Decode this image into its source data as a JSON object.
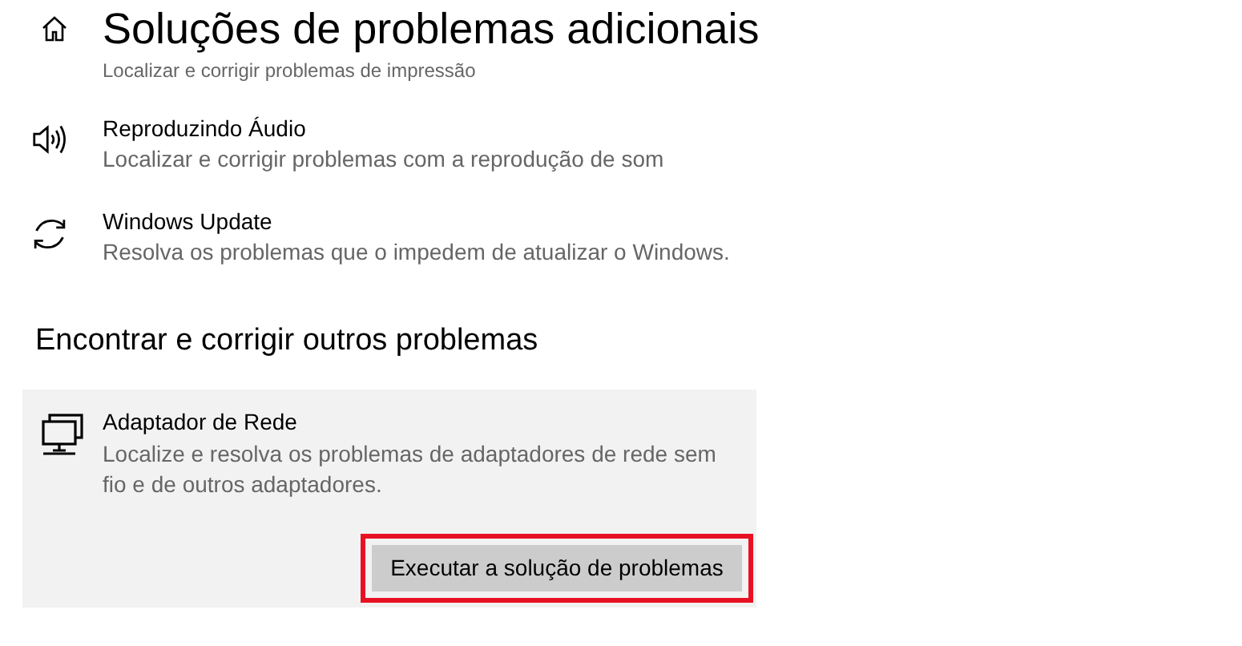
{
  "header": {
    "title": "Soluções de problemas adicionais"
  },
  "items": [
    {
      "kind": "printer",
      "description": "Localizar e corrigir problemas de impressão"
    },
    {
      "kind": "audio",
      "title": "Reproduzindo Áudio",
      "description": "Localizar e corrigir problemas com a reprodução de som"
    },
    {
      "kind": "update",
      "title": "Windows Update",
      "description": "Resolva os problemas que o impedem de atualizar o Windows."
    }
  ],
  "section": {
    "heading": "Encontrar e corrigir outros problemas",
    "card": {
      "kind": "network",
      "title": "Adaptador de Rede",
      "description": "Localize e resolva os problemas de adaptadores de rede sem fio e de outros adaptadores.",
      "button": "Executar a solução de problemas",
      "highlighted": true
    }
  }
}
